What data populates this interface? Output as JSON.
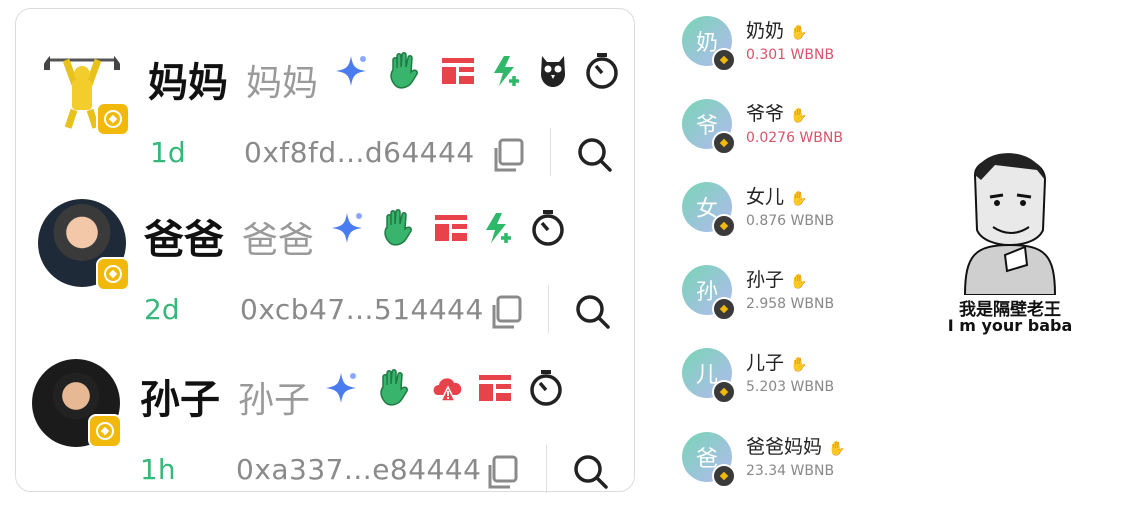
{
  "tokens": [
    {
      "ticker": "妈妈",
      "name": "妈妈",
      "age": "1d",
      "address": "0xf8fd...d64444"
    },
    {
      "ticker": "爸爸",
      "name": "爸爸",
      "age": "2d",
      "address": "0xcb47...514444"
    },
    {
      "ticker": "孙子",
      "name": "孙子",
      "age": "1h",
      "address": "0xa337...e84444"
    }
  ],
  "holders": [
    {
      "initial": "奶",
      "name": "奶奶",
      "amount": "0.301 WBNB"
    },
    {
      "initial": "爷",
      "name": "爷爷",
      "amount": "0.0276 WBNB"
    },
    {
      "initial": "女",
      "name": "女儿",
      "amount": "0.876 WBNB"
    },
    {
      "initial": "孙",
      "name": "孙子",
      "amount": "2.958 WBNB"
    },
    {
      "initial": "儿",
      "name": "儿子",
      "amount": "5.203 WBNB"
    },
    {
      "initial": "爸",
      "name": "爸爸妈妈",
      "amount": "23.34 WBNB"
    }
  ],
  "meme": {
    "line1": "我是隔壁老王",
    "line2": "I m your baba"
  },
  "colors": {
    "accent_green": "#35b87a",
    "bnb_yellow": "#f0b90b",
    "red_amount": "#d9536a",
    "sparkle_blue": "#4a7cf0",
    "hand_green": "#38b46c",
    "tag_red": "#e8434b"
  }
}
